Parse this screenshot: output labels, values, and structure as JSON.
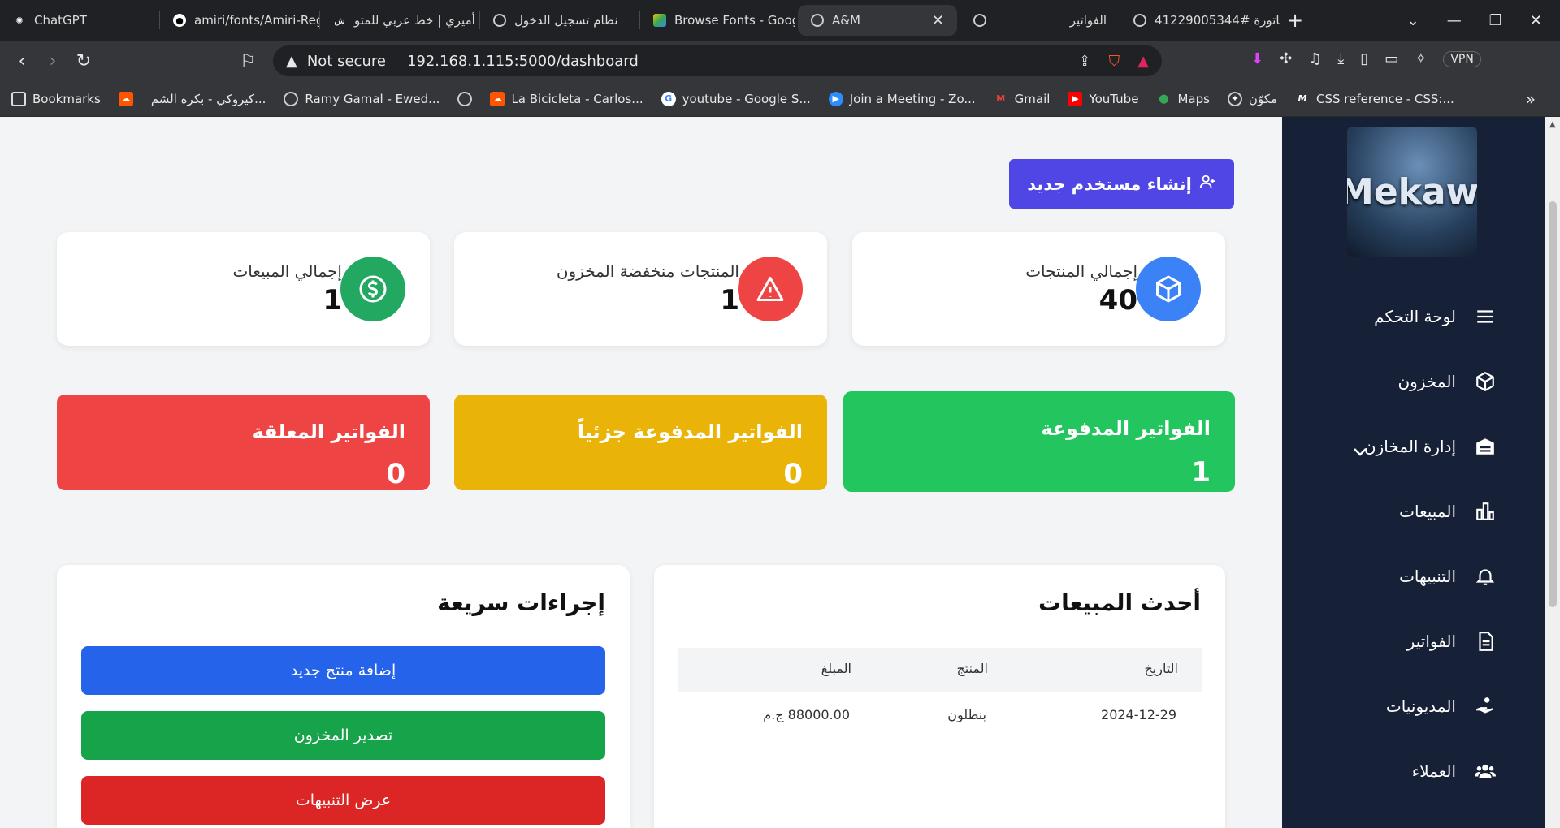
{
  "browser": {
    "tabs": [
      {
        "title": "ChatGPT",
        "icon": "chatgpt-icon"
      },
      {
        "title": "amiri/fonts/Amiri-Reg",
        "icon": "github-icon"
      },
      {
        "title": "أميري | خط عربي للمتو",
        "icon": "site-icon"
      },
      {
        "title": "نظام تسجيل الدخول",
        "icon": "globe-icon"
      },
      {
        "title": "Browse Fonts - Goog",
        "icon": "google-fonts-icon"
      },
      {
        "title": "A&M",
        "icon": "globe-icon",
        "active": true
      },
      {
        "title": "الفواتير",
        "icon": "globe-icon"
      },
      {
        "title": "فاتورة #41229005344",
        "icon": "globe-icon"
      }
    ],
    "address": {
      "security": "Not secure",
      "url": "192.168.1.115:5000/dashboard"
    },
    "vpn_label": "VPN",
    "bookmarks": [
      {
        "label": "Bookmarks",
        "icon": "bookmark-icon"
      },
      {
        "label": "",
        "icon": "soundcloud-icon"
      },
      {
        "label": "كيروكي - بكره الشم...",
        "icon": "none"
      },
      {
        "label": "Ramy Gamal - Ewed...",
        "icon": "globe-icon"
      },
      {
        "label": "",
        "icon": "globe-icon"
      },
      {
        "label": "La Bicicleta - Carlos...",
        "icon": "soundcloud-icon"
      },
      {
        "label": "youtube - Google S...",
        "icon": "google-icon"
      },
      {
        "label": "Join a Meeting - Zo...",
        "icon": "zoom-icon"
      },
      {
        "label": "Gmail",
        "icon": "gmail-icon"
      },
      {
        "label": "YouTube",
        "icon": "youtube-icon"
      },
      {
        "label": "Maps",
        "icon": "maps-icon"
      },
      {
        "label": "مكوّن",
        "icon": "mercedes-icon"
      },
      {
        "label": "CSS reference - CSS:...",
        "icon": "mdn-icon"
      }
    ]
  },
  "header": {
    "new_user_button": "إنشاء مستخدم جديد"
  },
  "stats": [
    {
      "title": "إجمالي المنتجات",
      "value": "40",
      "color": "#3b82f6",
      "icon": "cube-icon"
    },
    {
      "title": "المنتجات منخفضة المخزون",
      "value": "1",
      "color": "#ef4444",
      "icon": "warning-icon"
    },
    {
      "title": "إجمالي المبيعات",
      "value": "1",
      "color": "#22a861",
      "icon": "dollar-icon"
    }
  ],
  "invoices": [
    {
      "title": "الفواتير المدفوعة",
      "value": "1",
      "color": "#22c55e"
    },
    {
      "title": "الفواتير المدفوعة جزئياً",
      "value": "0",
      "color": "#eab308"
    },
    {
      "title": "الفواتير المعلقة",
      "value": "0",
      "color": "#ef4444"
    }
  ],
  "recent_sales": {
    "title": "أحدث المبيعات",
    "columns": [
      "التاريخ",
      "المنتج",
      "المبلغ"
    ],
    "rows": [
      {
        "date": "2024-12-29",
        "product": "بنطلون",
        "amount": "88000.00 ج.م"
      }
    ]
  },
  "quick_actions": {
    "title": "إجراءات سريعة",
    "buttons": [
      {
        "label": "إضافة منتج جديد",
        "color": "#2563eb"
      },
      {
        "label": "تصدير المخزون",
        "color": "#16a34a"
      },
      {
        "label": "عرض التنبيهات",
        "color": "#dc2626"
      }
    ]
  },
  "sidebar": {
    "logo_text": "Mekawy",
    "items": [
      {
        "label": "لوحة التحكم",
        "icon": "menu-icon"
      },
      {
        "label": "المخزون",
        "icon": "cube-icon"
      },
      {
        "label": "إدارة المخازن",
        "icon": "warehouse-icon"
      },
      {
        "label": "المبيعات",
        "icon": "bar-chart-icon"
      },
      {
        "label": "التنبيهات",
        "icon": "bell-icon"
      },
      {
        "label": "الفواتير",
        "icon": "document-icon"
      },
      {
        "label": "المديونيات",
        "icon": "hand-coin-icon"
      },
      {
        "label": "العملاء",
        "icon": "users-icon"
      }
    ]
  }
}
